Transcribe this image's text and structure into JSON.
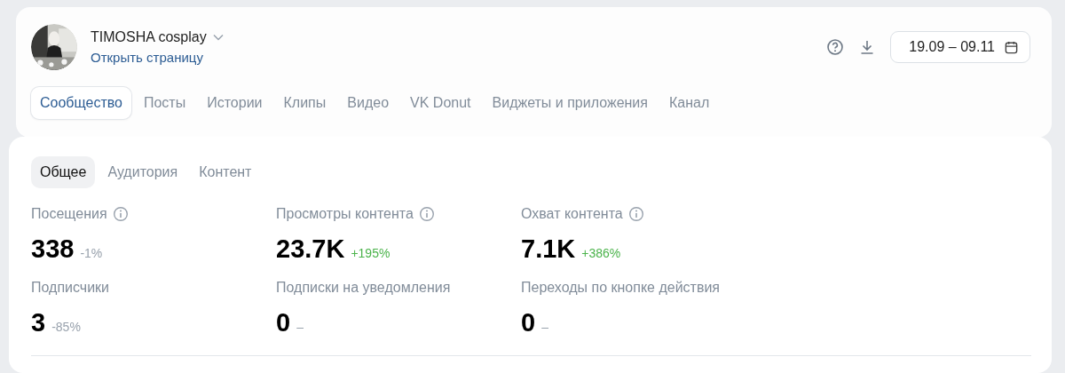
{
  "community": {
    "name": "TIMOSHA cosplay",
    "link": "Открыть страницу"
  },
  "date_range": "19.09 – 09.11",
  "tabs": [
    {
      "label": "Сообщество",
      "selected": true
    },
    {
      "label": "Посты",
      "selected": false
    },
    {
      "label": "Истории",
      "selected": false
    },
    {
      "label": "Клипы",
      "selected": false
    },
    {
      "label": "Видео",
      "selected": false
    },
    {
      "label": "VK Donut",
      "selected": false
    },
    {
      "label": "Виджеты и приложения",
      "selected": false
    },
    {
      "label": "Канал",
      "selected": false
    }
  ],
  "subtabs": [
    {
      "label": "Общее",
      "selected": true
    },
    {
      "label": "Аудитория",
      "selected": false
    },
    {
      "label": "Контент",
      "selected": false
    }
  ],
  "stats": [
    {
      "label": "Посещения",
      "info": true,
      "value": "338",
      "change": "-1%",
      "kind": "neutral"
    },
    {
      "label": "Просмотры контента",
      "info": true,
      "value": "23.7K",
      "change": "+195%",
      "kind": "positive"
    },
    {
      "label": "Охват контента",
      "info": true,
      "value": "7.1K",
      "change": "+386%",
      "kind": "positive"
    },
    {
      "label": "Подписчики",
      "info": false,
      "value": "3",
      "change": "-85%",
      "kind": "neutral"
    },
    {
      "label": "Подписки на уведомления",
      "info": false,
      "value": "0",
      "change": "–",
      "kind": "neutral"
    },
    {
      "label": "Переходы по кнопке действия",
      "info": false,
      "value": "0",
      "change": "–",
      "kind": "neutral"
    }
  ]
}
